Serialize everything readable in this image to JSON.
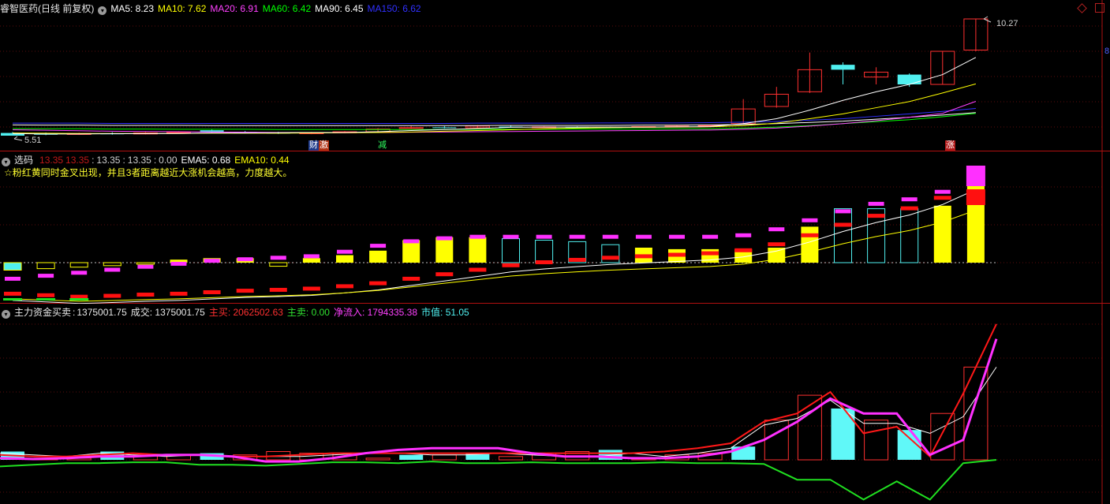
{
  "price_panel": {
    "title": "睿智医药(日线 前复权)",
    "ma": [
      {
        "label": "MA5: 8.23",
        "color": "#ffffff"
      },
      {
        "label": "MA10: 7.62",
        "color": "#ffff00"
      },
      {
        "label": "MA20: 6.91",
        "color": "#ff40ff"
      },
      {
        "label": "MA60: 6.42",
        "color": "#00ff00"
      },
      {
        "label": "MA90: 6.45",
        "color": "#ffffff"
      },
      {
        "label": "MA150: 6.62",
        "color": "#3030ff"
      }
    ],
    "high_label": "10.27",
    "low_label": "5.51",
    "axis_marker": "8",
    "events": [
      {
        "text": "财",
        "color": "#ffffff",
        "bg": "#1e3a8a"
      },
      {
        "text": "激",
        "color": "#ffffff",
        "bg": "#b03010"
      },
      {
        "text": "减",
        "color": "#30ff60",
        "bg": "#000000"
      },
      {
        "text": "涨",
        "color": "#ffffff",
        "bg": "#b01818"
      }
    ],
    "candles": [
      {
        "o": 5.62,
        "c": 5.51,
        "h": 5.66,
        "l": 5.51
      },
      {
        "o": 5.6,
        "c": 5.55,
        "h": 5.64,
        "l": 5.53
      },
      {
        "o": 5.56,
        "c": 5.6,
        "h": 5.63,
        "l": 5.54
      },
      {
        "o": 5.6,
        "c": 5.58,
        "h": 5.65,
        "l": 5.55
      },
      {
        "o": 5.58,
        "c": 5.62,
        "h": 5.66,
        "l": 5.56
      },
      {
        "o": 5.62,
        "c": 5.65,
        "h": 5.69,
        "l": 5.6
      },
      {
        "o": 5.73,
        "c": 5.65,
        "h": 5.76,
        "l": 5.63
      },
      {
        "o": 5.66,
        "c": 5.63,
        "h": 5.7,
        "l": 5.61
      },
      {
        "o": 5.63,
        "c": 5.6,
        "h": 5.67,
        "l": 5.58
      },
      {
        "o": 5.59,
        "c": 5.63,
        "h": 5.66,
        "l": 5.57
      },
      {
        "o": 5.63,
        "c": 5.67,
        "h": 5.7,
        "l": 5.61
      },
      {
        "o": 5.67,
        "c": 5.78,
        "h": 5.82,
        "l": 5.65
      },
      {
        "o": 5.8,
        "c": 5.84,
        "h": 5.92,
        "l": 5.78
      },
      {
        "o": 5.85,
        "c": 5.83,
        "h": 5.9,
        "l": 5.8
      },
      {
        "o": 5.83,
        "c": 5.9,
        "h": 5.94,
        "l": 5.8
      },
      {
        "o": 5.88,
        "c": 5.86,
        "h": 5.92,
        "l": 5.84
      },
      {
        "o": 5.86,
        "c": 5.87,
        "h": 5.9,
        "l": 5.84
      },
      {
        "o": 5.87,
        "c": 5.86,
        "h": 5.89,
        "l": 5.84
      },
      {
        "o": 5.86,
        "c": 5.85,
        "h": 5.88,
        "l": 5.83
      },
      {
        "o": 5.85,
        "c": 5.88,
        "h": 5.9,
        "l": 5.83
      },
      {
        "o": 5.88,
        "c": 5.9,
        "h": 5.93,
        "l": 5.86
      },
      {
        "o": 5.9,
        "c": 5.93,
        "h": 5.96,
        "l": 5.88
      },
      {
        "o": 6.0,
        "c": 6.6,
        "h": 7.0,
        "l": 5.98
      },
      {
        "o": 6.7,
        "c": 7.2,
        "h": 7.5,
        "l": 6.65
      },
      {
        "o": 7.3,
        "c": 8.2,
        "h": 8.9,
        "l": 7.25
      },
      {
        "o": 8.4,
        "c": 8.2,
        "h": 8.5,
        "l": 7.6
      },
      {
        "o": 7.9,
        "c": 8.1,
        "h": 8.3,
        "l": 7.6
      },
      {
        "o": 8.0,
        "c": 7.6,
        "h": 8.05,
        "l": 7.5
      },
      {
        "o": 7.6,
        "c": 8.95,
        "h": 8.95,
        "l": 7.6
      },
      {
        "o": 9.0,
        "c": 10.27,
        "h": 10.27,
        "l": 8.95
      }
    ],
    "ma5": [
      5.6,
      5.58,
      5.58,
      5.59,
      5.59,
      5.6,
      5.62,
      5.62,
      5.63,
      5.64,
      5.64,
      5.67,
      5.72,
      5.76,
      5.8,
      5.85,
      5.86,
      5.86,
      5.86,
      5.86,
      5.87,
      5.88,
      6.0,
      6.2,
      6.55,
      6.95,
      7.3,
      7.6,
      8.0,
      8.7
    ],
    "ma10": [
      5.62,
      5.61,
      5.6,
      5.6,
      5.6,
      5.6,
      5.61,
      5.61,
      5.61,
      5.62,
      5.63,
      5.64,
      5.66,
      5.69,
      5.72,
      5.75,
      5.79,
      5.82,
      5.84,
      5.85,
      5.86,
      5.87,
      5.92,
      6.02,
      6.2,
      6.4,
      6.65,
      6.9,
      7.25,
      7.62
    ],
    "ma20": [
      5.75,
      5.73,
      5.71,
      5.69,
      5.68,
      5.67,
      5.66,
      5.65,
      5.64,
      5.64,
      5.64,
      5.64,
      5.65,
      5.66,
      5.67,
      5.68,
      5.69,
      5.7,
      5.71,
      5.72,
      5.73,
      5.74,
      5.77,
      5.82,
      5.9,
      6.0,
      6.12,
      6.26,
      6.42,
      6.91
    ],
    "ma60": [
      5.8,
      5.79,
      5.79,
      5.78,
      5.78,
      5.77,
      5.77,
      5.77,
      5.76,
      5.76,
      5.76,
      5.76,
      5.76,
      5.76,
      5.77,
      5.77,
      5.77,
      5.78,
      5.78,
      5.78,
      5.79,
      5.79,
      5.82,
      5.86,
      5.92,
      6.0,
      6.08,
      6.16,
      6.28,
      6.42
    ],
    "ma90": [
      5.95,
      5.94,
      5.94,
      5.93,
      5.93,
      5.93,
      5.92,
      5.92,
      5.92,
      5.92,
      5.92,
      5.92,
      5.92,
      5.92,
      5.92,
      5.93,
      5.93,
      5.93,
      5.93,
      5.94,
      5.94,
      5.95,
      5.97,
      6.0,
      6.05,
      6.1,
      6.18,
      6.26,
      6.35,
      6.45
    ],
    "ma150": [
      6.02,
      6.02,
      6.02,
      6.01,
      6.01,
      6.01,
      6.01,
      6.01,
      6.01,
      6.01,
      6.01,
      6.01,
      6.01,
      6.01,
      6.02,
      6.02,
      6.02,
      6.02,
      6.03,
      6.03,
      6.03,
      6.04,
      6.06,
      6.09,
      6.14,
      6.2,
      6.3,
      6.4,
      6.5,
      6.62
    ]
  },
  "xuanma_panel": {
    "name": "选码",
    "values": [
      {
        "text": "13.35",
        "color": "#ff2020"
      },
      {
        "text": "13.35",
        "color": "#ff2020"
      },
      {
        "text": "13.35",
        "color": "#ffffff"
      },
      {
        "text": "13.35",
        "color": "#ffffff"
      },
      {
        "text": "0.00",
        "color": "#ffffff"
      }
    ],
    "ema5_label": "EMA5: 0.68",
    "ema10_label": "EMA10: 0.44",
    "note": "☆粉红黄同时金叉出现，并且3者距离越近大涨机会越高，力度越大。",
    "main": [
      -0.25,
      -0.2,
      -0.15,
      -0.1,
      -0.05,
      0.1,
      0.15,
      0.15,
      -0.12,
      0.15,
      0.25,
      0.4,
      0.75,
      0.85,
      0.85,
      0.8,
      0.75,
      0.7,
      0.6,
      0.5,
      0.45,
      0.45,
      0.45,
      0.5,
      1.2,
      1.8,
      1.8,
      1.8,
      1.9,
      3.0
    ],
    "red": [
      -1.05,
      -1.1,
      -1.15,
      -1.12,
      -1.08,
      -1.05,
      -1.0,
      -0.95,
      -0.92,
      -0.88,
      -0.8,
      -0.7,
      -0.55,
      -0.4,
      -0.25,
      -0.1,
      0.0,
      0.08,
      0.15,
      0.2,
      0.25,
      0.3,
      0.4,
      0.6,
      0.9,
      1.25,
      1.55,
      1.8,
      2.15,
      2.65
    ],
    "pink": [
      -0.55,
      -0.45,
      -0.35,
      -0.25,
      -0.15,
      -0.05,
      0.05,
      0.1,
      0.15,
      0.2,
      0.35,
      0.55,
      0.7,
      0.8,
      0.85,
      0.85,
      0.85,
      0.85,
      0.85,
      0.85,
      0.85,
      0.85,
      0.9,
      1.1,
      1.4,
      1.7,
      1.95,
      2.1,
      2.35,
      3.0
    ]
  },
  "flow_panel": {
    "name": "主力资金买卖",
    "name_value": "1375001.75",
    "chengjiao": "成交: 1375001.75",
    "zhumai": "主买: 2062502.63",
    "zhumai2": "主卖: 0.00",
    "jingliuru": "净流入: 1794335.38",
    "shizhi": "市值: 51.05",
    "bars": [
      0.5,
      0.1,
      0.1,
      0.5,
      0.3,
      0.3,
      0.4,
      0.3,
      0.5,
      0.4,
      0.4,
      0.1,
      0.3,
      0.3,
      0.4,
      0.2,
      0.4,
      0.5,
      0.6,
      0.1,
      0.3,
      0.4,
      0.8,
      2.4,
      3.9,
      3.1,
      2.4,
      1.8,
      2.8,
      5.6
    ],
    "bar_colors_cyan": [
      0,
      3,
      6,
      12,
      14,
      18,
      22,
      25,
      27
    ],
    "red": [
      0.3,
      0.2,
      0.2,
      0.3,
      0.4,
      0.3,
      0.3,
      0.2,
      0.2,
      0.3,
      0.4,
      0.4,
      0.4,
      0.4,
      0.4,
      0.4,
      0.4,
      0.4,
      0.4,
      0.4,
      0.5,
      0.7,
      1.0,
      2.3,
      2.8,
      4.1,
      1.6,
      2.0,
      0.2,
      4.0,
      8.2
    ],
    "white": [
      0.4,
      0.3,
      0.2,
      0.4,
      0.3,
      0.2,
      0.3,
      0.2,
      0.2,
      0.2,
      0.3,
      0.4,
      0.4,
      0.3,
      0.3,
      0.4,
      0.3,
      0.2,
      0.2,
      0.4,
      0.2,
      0.4,
      0.7,
      2.1,
      2.5,
      3.6,
      2.2,
      2.2,
      1.6,
      2.6,
      5.6
    ],
    "magenta": [
      0.1,
      0.05,
      0.1,
      0.2,
      0.2,
      0.3,
      0.3,
      0.2,
      -0.1,
      -0.1,
      0.1,
      0.4,
      0.6,
      0.7,
      0.7,
      0.7,
      0.4,
      0.2,
      0.2,
      0.1,
      0.1,
      0.2,
      0.5,
      1.2,
      2.3,
      3.7,
      2.8,
      2.8,
      0.3,
      1.2,
      7.3
    ],
    "green": [
      -0.4,
      -0.3,
      -0.2,
      -0.2,
      -0.15,
      -0.15,
      -0.3,
      -0.3,
      -0.35,
      -0.25,
      -0.15,
      -0.15,
      -0.2,
      -0.1,
      -0.2,
      -0.2,
      -0.15,
      -0.2,
      -0.2,
      -0.2,
      -0.15,
      -0.2,
      -0.2,
      -0.25,
      -1.2,
      -1.2,
      -2.4,
      -1.3,
      -2.4,
      -0.2,
      0.0
    ]
  },
  "colors": {
    "background": "#000000",
    "divider": "#b01010",
    "up": "#ff3030",
    "down": "#50f0f0",
    "yellow": "#ffff00",
    "magenta": "#ff30ff",
    "green": "#20e020"
  }
}
